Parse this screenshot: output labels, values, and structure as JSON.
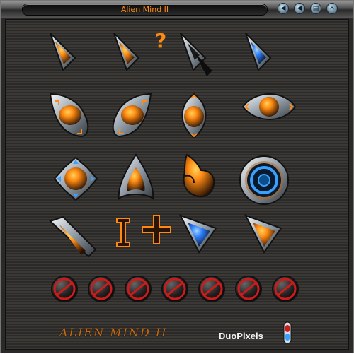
{
  "window": {
    "title": "Alien Mind II"
  },
  "title_buttons": [
    {
      "name": "back-button",
      "glyph": "◀"
    },
    {
      "name": "prev-button",
      "glyph": "◀"
    },
    {
      "name": "menu-button",
      "glyph": "▤"
    },
    {
      "name": "close-button",
      "glyph": "✕"
    }
  ],
  "footer": {
    "brand": "ALIEN MIND II",
    "maker": "DuoPixels"
  },
  "icons": [
    "arrow-cursor-orange-icon",
    "help-cursor-icon",
    "arrow-cursor-black-icon",
    "arrow-cursor-blue-icon",
    "resize-diagonal-icon",
    "resize-diagonal-alt-icon",
    "resize-vertical-icon",
    "resize-horizontal-icon",
    "move-cursor-icon",
    "arrow-up-cursor-icon",
    "hand-pointer-icon",
    "busy-ring-icon",
    "pen-cursor-icon",
    "text-cursor-icon",
    "crosshair-icon",
    "arrow-cursor-alt-icon",
    "arrow-cursor-alt-blue-icon",
    "unavailable-icon"
  ],
  "colors": {
    "accent": "#ff8a12",
    "blue": "#3aa0ff",
    "metal": "#a7b1bb",
    "red": "#cc1b1b"
  }
}
